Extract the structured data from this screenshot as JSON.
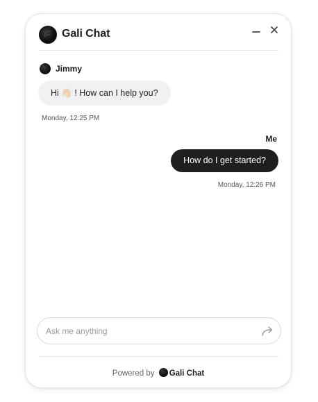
{
  "header": {
    "title": "Gali Chat",
    "logo_icon": "gali-chat-logo-icon",
    "minimize_icon": "minimize-icon",
    "close_icon": "close-icon"
  },
  "messages": [
    {
      "sender": "Jimmy",
      "avatar_icon": "agent-avatar-icon",
      "text": "Hi 👋🏻 ! How can I help you?",
      "timestamp": "Monday, 12:25 PM"
    },
    {
      "sender": "Me",
      "text": "How do I get started?",
      "timestamp": "Monday, 12:26 PM"
    }
  ],
  "composer": {
    "placeholder": "Ask me anything",
    "value": "",
    "send_icon": "send-arrow-icon"
  },
  "footer": {
    "powered_by": "Powered by",
    "brand": "Gali Chat"
  },
  "colors": {
    "outgoing_bubble": "#1f1f1f",
    "incoming_bubble": "#f1f1f1",
    "border": "#e5e5e5"
  }
}
